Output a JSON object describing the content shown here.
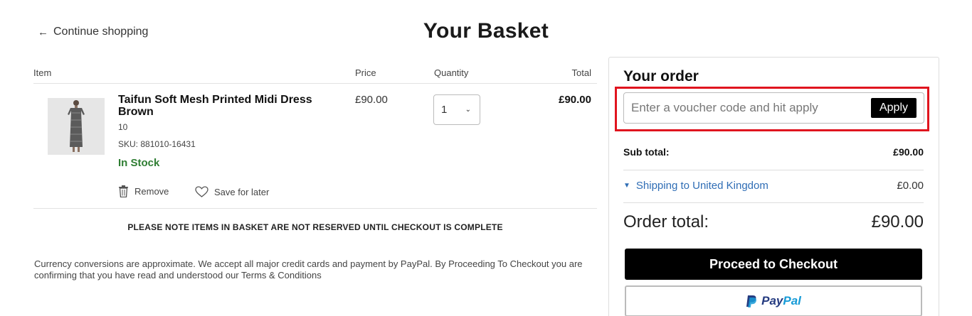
{
  "header": {
    "continue_label": "Continue shopping",
    "title": "Your Basket"
  },
  "table": {
    "columns": {
      "item": "Item",
      "price": "Price",
      "quantity": "Quantity",
      "total": "Total"
    }
  },
  "item": {
    "name": "Taifun Soft Mesh Printed Midi Dress Brown",
    "size": "10",
    "sku": "SKU: 881010-16431",
    "stock": "In Stock",
    "price": "£90.00",
    "quantity": "1",
    "total": "£90.00",
    "remove_label": "Remove",
    "save_label": "Save for later"
  },
  "notice": "PLEASE NOTE ITEMS IN BASKET ARE NOT RESERVED UNTIL CHECKOUT IS COMPLETE",
  "disclaimer": "Currency conversions are approximate. We accept all major credit cards and payment by PayPal. By Proceeding To Checkout you are confirming that you have read and understood our Terms & Conditions",
  "order": {
    "title": "Your order",
    "voucher_placeholder": "Enter a voucher code and hit apply",
    "apply_label": "Apply",
    "subtotal_label": "Sub total:",
    "subtotal_value": "£90.00",
    "shipping_label": "Shipping to United Kingdom",
    "shipping_value": "£0.00",
    "total_label": "Order total:",
    "total_value": "£90.00",
    "checkout_label": "Proceed to Checkout",
    "paypal_label_1": "Pay",
    "paypal_label_2": "Pal"
  },
  "colors": {
    "stock_green": "#2e7d32",
    "link_blue": "#2f6db5",
    "highlight_red": "#e0141e",
    "paypal_dark": "#253b80",
    "paypal_light": "#179bd7"
  }
}
